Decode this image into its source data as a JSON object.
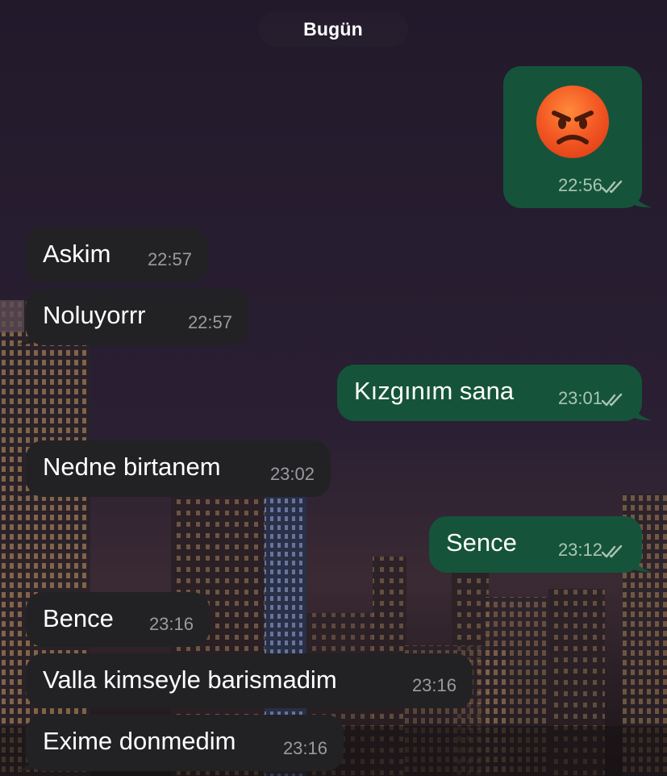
{
  "date_separator": "Bugün",
  "emoji_message": {
    "emoji": "😡",
    "time": "22:56",
    "status": "read"
  },
  "messages": [
    {
      "direction": "incoming",
      "text": "Askim",
      "time": "22:57"
    },
    {
      "direction": "incoming",
      "text": "Noluyorrr",
      "time": "22:57"
    },
    {
      "direction": "outgoing",
      "text": "Kızgınım sana",
      "time": "23:01",
      "status": "read"
    },
    {
      "direction": "incoming",
      "text": "Nedne birtanem",
      "time": "23:02"
    },
    {
      "direction": "outgoing",
      "text": "Sence",
      "time": "23:12",
      "status": "read"
    },
    {
      "direction": "incoming",
      "text": "Bence",
      "time": "23:16"
    },
    {
      "direction": "incoming",
      "text": "Valla kimseyle barismadim",
      "time": "23:16"
    },
    {
      "direction": "incoming",
      "text": "Exime donmedim",
      "time": "23:16"
    }
  ],
  "colors": {
    "incoming_bubble": "#222224",
    "outgoing_bubble": "#15543a",
    "read_ticks": "#a9c5b6",
    "background": "#261c30"
  },
  "icons": {
    "read_status": "double-check-icon",
    "emoji": "angry-face-icon"
  }
}
